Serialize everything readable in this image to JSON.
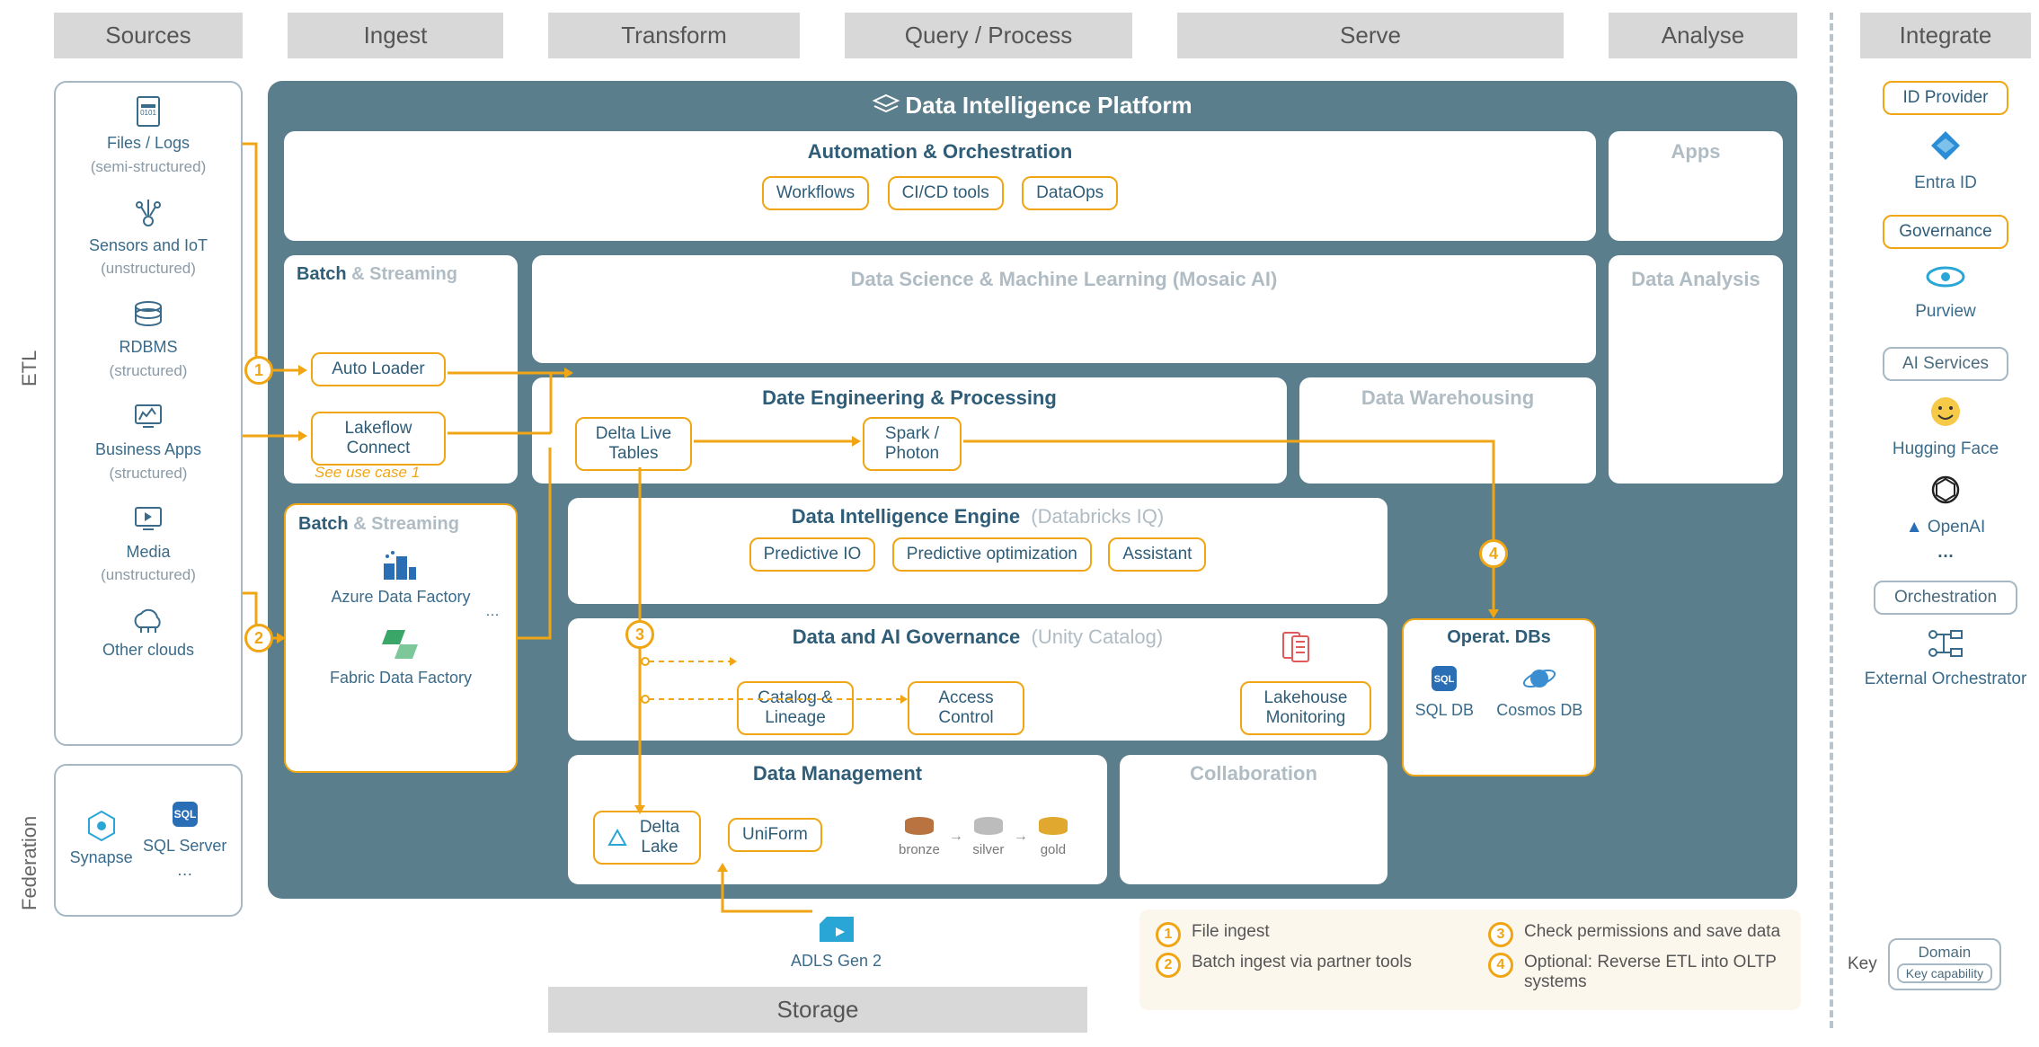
{
  "columns": {
    "sources": "Sources",
    "ingest": "Ingest",
    "transform": "Transform",
    "query": "Query / Process",
    "serve": "Serve",
    "analyse": "Analyse",
    "integrate": "Integrate"
  },
  "side_labels": {
    "etl": "ETL",
    "federation": "Federation"
  },
  "sources": {
    "files": {
      "title": "Files / Logs",
      "sub": "(semi-structured)"
    },
    "sensors": {
      "title": "Sensors and IoT",
      "sub": "(unstructured)"
    },
    "rdbms": {
      "title": "RDBMS",
      "sub": "(structured)"
    },
    "bizapps": {
      "title": "Business Apps",
      "sub": "(structured)"
    },
    "media": {
      "title": "Media",
      "sub": "(unstructured)"
    },
    "other": {
      "title": "Other clouds"
    },
    "fed": {
      "synapse": "Synapse",
      "sql": "SQL Server",
      "ellipsis": "…"
    }
  },
  "ingest": {
    "box1": {
      "title_a": "Batch",
      "title_b": " & Streaming",
      "auto_loader": "Auto Loader",
      "lakeflow": "Lakeflow Connect",
      "note": "See use case 1"
    },
    "box2": {
      "title_a": "Batch",
      "title_b": " & Streaming",
      "adf": "Azure Data Factory",
      "fdf": "Fabric Data Factory",
      "ellipsis": "…"
    }
  },
  "platform": {
    "title": "Data Intelligence Platform",
    "automation": {
      "title": "Automation & Orchestration",
      "workflows": "Workflows",
      "cicd": "CI/CD tools",
      "dataops": "DataOps"
    },
    "apps": "Apps",
    "dsml": "Data Science & Machine Learning  (Mosaic AI)",
    "data_analysis": "Data Analysis",
    "deproc": {
      "title": "Date Engineering & Processing",
      "dlt": "Delta Live Tables",
      "spark": "Spark / Photon"
    },
    "dwh": "Data Warehousing",
    "die": {
      "title_a": "Data Intelligence Engine",
      "title_b": "(Databricks IQ)",
      "pio": "Predictive IO",
      "popt": "Predictive optimization",
      "assistant": "Assistant"
    },
    "gov": {
      "title_a": "Data and AI Governance",
      "title_b": "(Unity Catalog)",
      "catalog": "Catalog & Lineage",
      "access": "Access Control",
      "monitoring": "Lakehouse Monitoring"
    },
    "dm": {
      "title": "Data Management",
      "delta": "Delta Lake",
      "uniform": "UniForm",
      "bronze": "bronze",
      "silver": "silver",
      "gold": "gold"
    },
    "collab": "Collaboration",
    "operat": {
      "title": "Operat. DBs",
      "sql": "SQL DB",
      "cosmos": "Cosmos DB"
    }
  },
  "storage": {
    "adls": "ADLS Gen 2",
    "header": "Storage"
  },
  "steps": {
    "s1": "1",
    "s2": "2",
    "s3": "3",
    "s4": "4"
  },
  "legend": {
    "l1": "File ingest",
    "l2": "Batch ingest via partner tools",
    "l3": "Check permissions and save data",
    "l4": "Optional: Reverse ETL into OLTP systems"
  },
  "integrate": {
    "idp": "ID Provider",
    "entra": "Entra ID",
    "gov": "Governance",
    "purview": "Purview",
    "ais": "AI Services",
    "hf": "Hugging Face",
    "openai": "OpenAI",
    "ellipsis": "…",
    "orch": "Orchestration",
    "ext": "External Orchestrator"
  },
  "key": {
    "label": "Key",
    "domain": "Domain",
    "cap": "Key capability"
  }
}
